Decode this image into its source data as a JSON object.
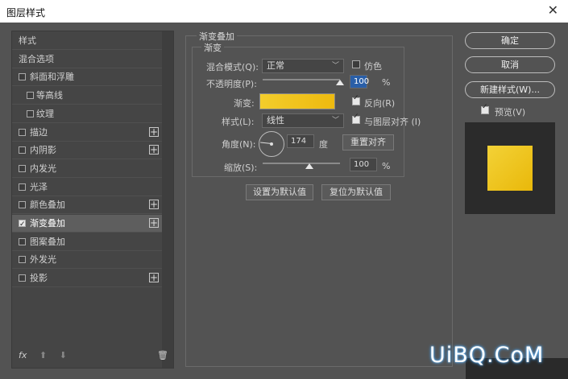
{
  "window": {
    "title": "图层样式"
  },
  "left_panel": {
    "items": [
      {
        "label": "样式",
        "check": "none",
        "plus": false,
        "indent": false,
        "selected": false
      },
      {
        "label": "混合选项",
        "check": "none",
        "plus": false,
        "indent": false,
        "selected": false
      },
      {
        "label": "斜面和浮雕",
        "check": "off",
        "plus": false,
        "indent": false,
        "selected": false
      },
      {
        "label": "等高线",
        "check": "off",
        "plus": false,
        "indent": true,
        "selected": false
      },
      {
        "label": "纹理",
        "check": "off",
        "plus": false,
        "indent": true,
        "selected": false
      },
      {
        "label": "描边",
        "check": "off",
        "plus": true,
        "indent": false,
        "selected": false
      },
      {
        "label": "内阴影",
        "check": "off",
        "plus": true,
        "indent": false,
        "selected": false
      },
      {
        "label": "内发光",
        "check": "off",
        "plus": false,
        "indent": false,
        "selected": false
      },
      {
        "label": "光泽",
        "check": "off",
        "plus": false,
        "indent": false,
        "selected": false
      },
      {
        "label": "颜色叠加",
        "check": "off",
        "plus": true,
        "indent": false,
        "selected": false
      },
      {
        "label": "渐变叠加",
        "check": "on",
        "plus": true,
        "indent": false,
        "selected": true
      },
      {
        "label": "图案叠加",
        "check": "off",
        "plus": false,
        "indent": false,
        "selected": false
      },
      {
        "label": "外发光",
        "check": "off",
        "plus": false,
        "indent": false,
        "selected": false
      },
      {
        "label": "投影",
        "check": "off",
        "plus": true,
        "indent": false,
        "selected": false
      }
    ],
    "footer": {
      "fx": "fx",
      "up": "⬆",
      "down": "⬇",
      "trash": "🗑"
    }
  },
  "panel": {
    "section_title": "渐变叠加",
    "subsection": "渐变",
    "blend_mode_label": "混合模式(Q):",
    "blend_mode_value": "正常",
    "dither_label": "仿色",
    "opacity_label": "不透明度(P):",
    "opacity_value": "100",
    "opacity_unit": "%",
    "opacity_level": 1.0,
    "gradient_label": "渐变:",
    "reverse_label": "反向(R)",
    "style_label": "样式(L):",
    "style_value": "线性",
    "align_label": "与图层对齐 (I)",
    "angle_label": "角度(N):",
    "angle_value": "174",
    "angle_unit": "度",
    "reset_align_button": "重置对齐",
    "scale_label": "缩放(S):",
    "scale_value": "100",
    "scale_unit": "%",
    "scale_level": 0.5,
    "set_default_button": "设置为默认值",
    "reset_default_button": "复位为默认值"
  },
  "right": {
    "ok_button": "确定",
    "cancel_button": "取消",
    "new_style_button": "新建样式(W)...",
    "preview_label": "预览(V)"
  },
  "watermark": "UiBQ.CoM",
  "colors": {
    "gradient_start": "#f3cd2c",
    "gradient_end": "#edba0f",
    "selection": "#2a5fa8"
  }
}
